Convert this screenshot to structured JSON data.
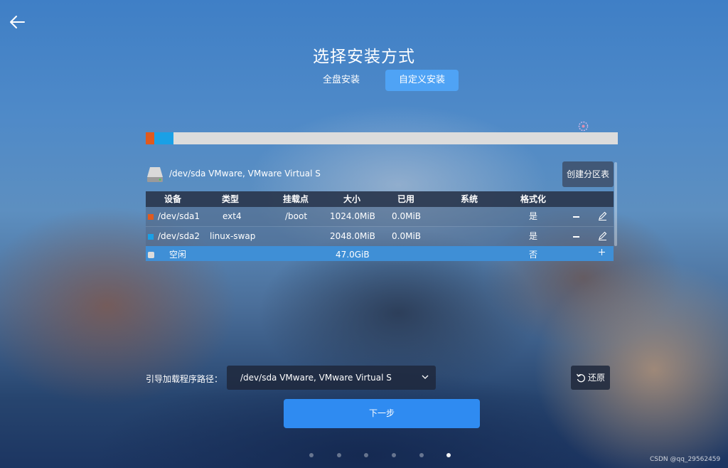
{
  "header": {
    "title": "选择安装方式"
  },
  "tabs": [
    {
      "label": "全盘安装",
      "active": false
    },
    {
      "label": "自定义安装",
      "active": true
    }
  ],
  "disk": {
    "label": "/dev/sda VMware, VMware Virtual S",
    "create_table_label": "创建分区表"
  },
  "table": {
    "columns": [
      "设备",
      "类型",
      "挂载点",
      "大小",
      "已用",
      "系统",
      "格式化"
    ],
    "rows": [
      {
        "device": "/dev/sda1",
        "type": "ext4",
        "mount": "/boot",
        "size": "1024.0MiB",
        "used": "0.0MiB",
        "system": "",
        "format": "是",
        "color": "#e05a1e"
      },
      {
        "device": "/dev/sda2",
        "type": "linux-swap",
        "mount": "",
        "size": "2048.0MiB",
        "used": "0.0MiB",
        "system": "",
        "format": "是",
        "color": "#1aa0e6"
      },
      {
        "device": "空闲",
        "type": "",
        "mount": "",
        "size": "47.0GiB",
        "used": "",
        "system": "",
        "format": "否",
        "color": "#dcdcdc"
      }
    ]
  },
  "bootloader": {
    "label": "引导加载程序路径：",
    "value": "/dev/sda VMware, VMware Virtual S"
  },
  "restore_label": "还原",
  "next_label": "下一步",
  "pagination": {
    "total": 6,
    "current": 6
  },
  "watermark": "CSDN @qq_29562459",
  "colors": {
    "accent": "#2f8bf1",
    "tab_active": "#4fa3f5",
    "sda1": "#e05a1e",
    "sda2": "#1aa0e6"
  }
}
